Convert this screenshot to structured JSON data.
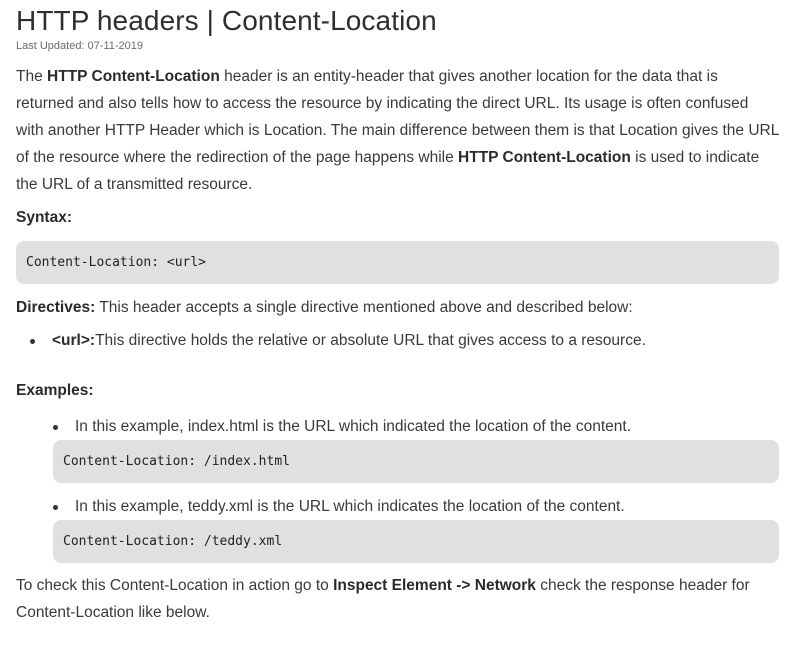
{
  "article": {
    "title": "HTTP headers | Content-Location",
    "last_updated": "Last Updated: 07-11-2019",
    "intro": {
      "t1": "The ",
      "b1": "HTTP Content-Location",
      "t2": " header is an entity-header that gives another location for the data that is returned and also tells how to access the resource by indicating the direct URL. Its usage is often confused with another HTTP Header which is Location. The main difference between them is that Location gives the URL of the resource where the redirection of the page happens while ",
      "b2": "HTTP Content-Location",
      "t3": " is used to indicate the URL of a transmitted resource."
    },
    "syntax_label": "Syntax:",
    "syntax_code": "Content-Location: <url>",
    "directives": {
      "label": "Directives:",
      "text": " This header accepts a single directive mentioned above and described below:",
      "items": [
        {
          "name": "<url>:",
          "desc": "This directive holds the relative or absolute URL that gives access to a resource."
        }
      ]
    },
    "examples_label": "Examples:",
    "examples": [
      {
        "text": "In this example, index.html is the URL which indicated the location of the content.",
        "code": "Content-Location: /index.html"
      },
      {
        "text": "In this example, teddy.xml is the URL which indicates the location of the content.",
        "code": "Content-Location: /teddy.xml"
      }
    ],
    "outro": {
      "t1": "To check this Content-Location in action go to ",
      "b1": "Inspect Element -> Network",
      "t2": " check the response header for Content-Location like below."
    }
  }
}
